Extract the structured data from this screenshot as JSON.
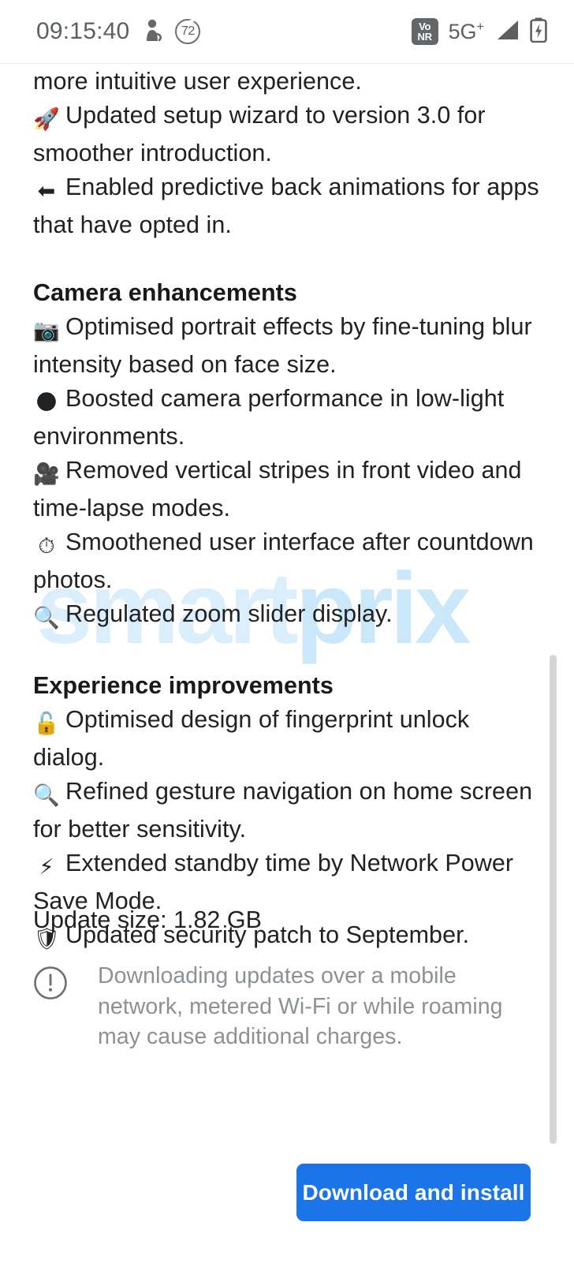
{
  "status_bar": {
    "clock": "09:15:40",
    "icons": {
      "person_icon": "person-silhouette-icon",
      "badge_count": "72",
      "vonr_top": "Vo",
      "vonr_bottom": "NR",
      "network": "5G",
      "network_sup": "+",
      "signal_icon": "signal-bars-icon",
      "battery_icon": "battery-charging-icon"
    }
  },
  "watermark": {
    "part_a": "smart",
    "part_b": "prix"
  },
  "release_notes": {
    "intro_lines": [
      {
        "emoji": "",
        "text": "more intuitive user experience."
      },
      {
        "emoji": "🚀",
        "emoji_name": "rocket-emoji",
        "text": "Updated setup wizard to version 3.0 for smoother introduction."
      },
      {
        "emoji": "⬅",
        "emoji_name": "back-arrow-emoji",
        "text": "Enabled predictive back animations for apps that have opted in."
      }
    ],
    "sections": [
      {
        "heading": "Camera enhancements",
        "items": [
          {
            "emoji": "📷",
            "emoji_name": "camera-emoji",
            "text": "Optimised portrait effects by fine-tuning blur intensity based on face size."
          },
          {
            "emoji": "🌑",
            "emoji_name": "new-moon-emoji",
            "text": "Boosted camera performance in low-light environments."
          },
          {
            "emoji": "🎥",
            "emoji_name": "movie-camera-emoji",
            "text": "Removed vertical stripes in front video and time-lapse modes."
          },
          {
            "emoji": "⏱",
            "emoji_name": "stopwatch-emoji",
            "text": "Smoothened user interface after countdown photos."
          },
          {
            "emoji": "🔍",
            "emoji_name": "magnifying-glass-emoji",
            "text": "Regulated zoom slider display."
          }
        ]
      },
      {
        "heading": "Experience improvements",
        "items": [
          {
            "emoji": "🔓",
            "emoji_name": "unlocked-padlock-emoji",
            "text": "Optimised design of fingerprint unlock dialog."
          },
          {
            "emoji": "🔍",
            "emoji_name": "magnifying-glass-emoji",
            "text": "Refined gesture navigation on home screen for better sensitivity."
          },
          {
            "emoji": "⚡",
            "emoji_name": "high-voltage-emoji",
            "text": "Extended standby time by Network Power Save Mode."
          },
          {
            "emoji": "🛡",
            "emoji_name": "shield-emoji",
            "text": "Updated security patch to September."
          }
        ]
      }
    ]
  },
  "update_size_label": "Update size: 1.82 GB",
  "warning": {
    "icon": "exclamation-circle-icon",
    "text": "Downloading updates over a mobile network, metered Wi-Fi or while roaming may cause additional charges."
  },
  "actions": {
    "download_install_label": "Download and install"
  },
  "colors": {
    "accent_button": "#1b74e8",
    "body_text": "#1f2123",
    "muted_text": "#8d9194",
    "watermark_light": "#dbeefb",
    "watermark_dark": "#cbe7fa",
    "scrollbar": "#d4d5d6",
    "status_icon": "#5c6063"
  }
}
